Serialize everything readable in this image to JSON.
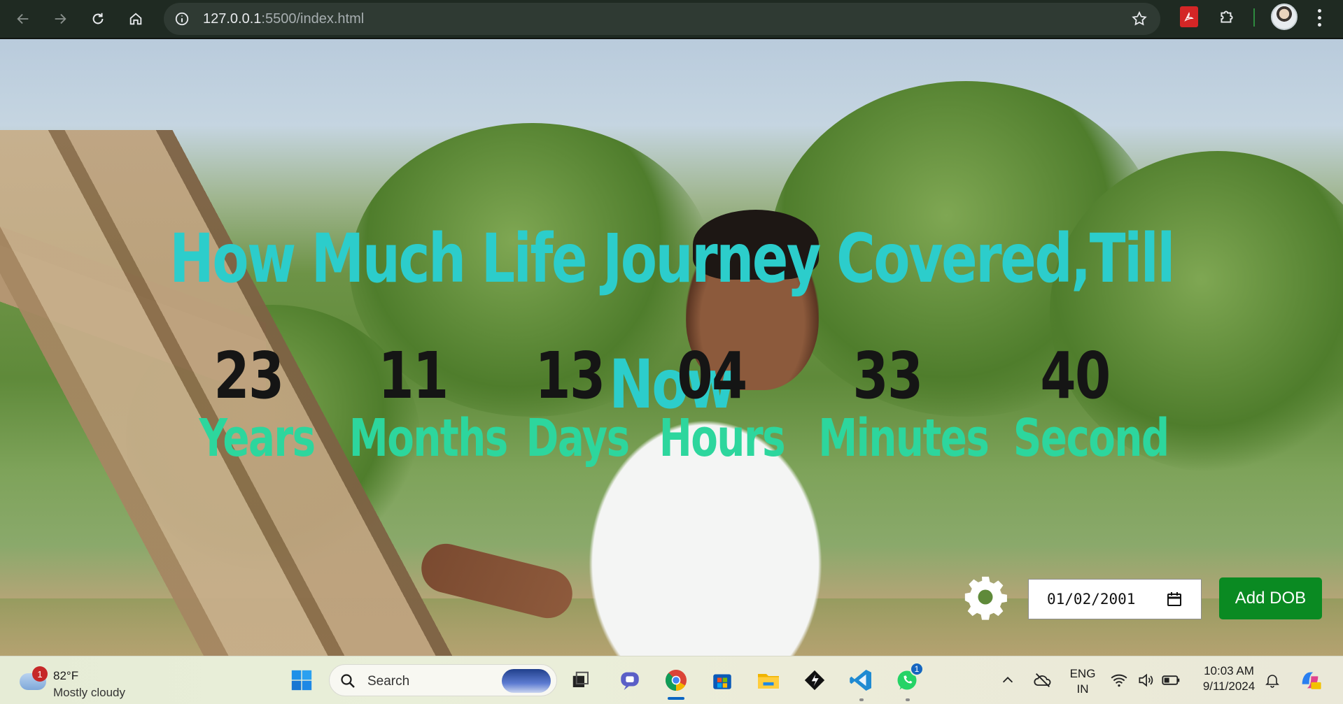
{
  "browser": {
    "url_host": "127.0.0.1",
    "url_rest": ":5500/index.html",
    "icons": [
      "back-icon",
      "forward-icon",
      "reload-icon",
      "home-icon",
      "site-info-icon",
      "bookmark-star-icon",
      "pdf-extension-icon",
      "extensions-puzzle-icon",
      "profile-avatar",
      "menu-kebab-icon"
    ]
  },
  "page": {
    "headline": "How Much Life Journey Covered,Till Now",
    "counters": [
      {
        "value": "23",
        "label": "Years"
      },
      {
        "value": "11",
        "label": "Months"
      },
      {
        "value": "13",
        "label": "Days"
      },
      {
        "value": "04",
        "label": "Hours"
      },
      {
        "value": "33",
        "label": "Minutes"
      },
      {
        "value": "40",
        "label": "Second"
      }
    ],
    "dob_value": "01/02/2001",
    "add_button": "Add DOB",
    "colors": {
      "headline": "#2ccdcb",
      "number": "#151515",
      "label": "#2dd69d",
      "button": "#0a8a22"
    }
  },
  "taskbar": {
    "weather": {
      "badge": "1",
      "temp": "82°F",
      "condition": "Mostly cloudy"
    },
    "search_placeholder": "Search",
    "whatsapp_badge": "1",
    "lang_top": "ENG",
    "lang_bottom": "IN",
    "time": "10:03 AM",
    "date": "9/11/2024"
  }
}
